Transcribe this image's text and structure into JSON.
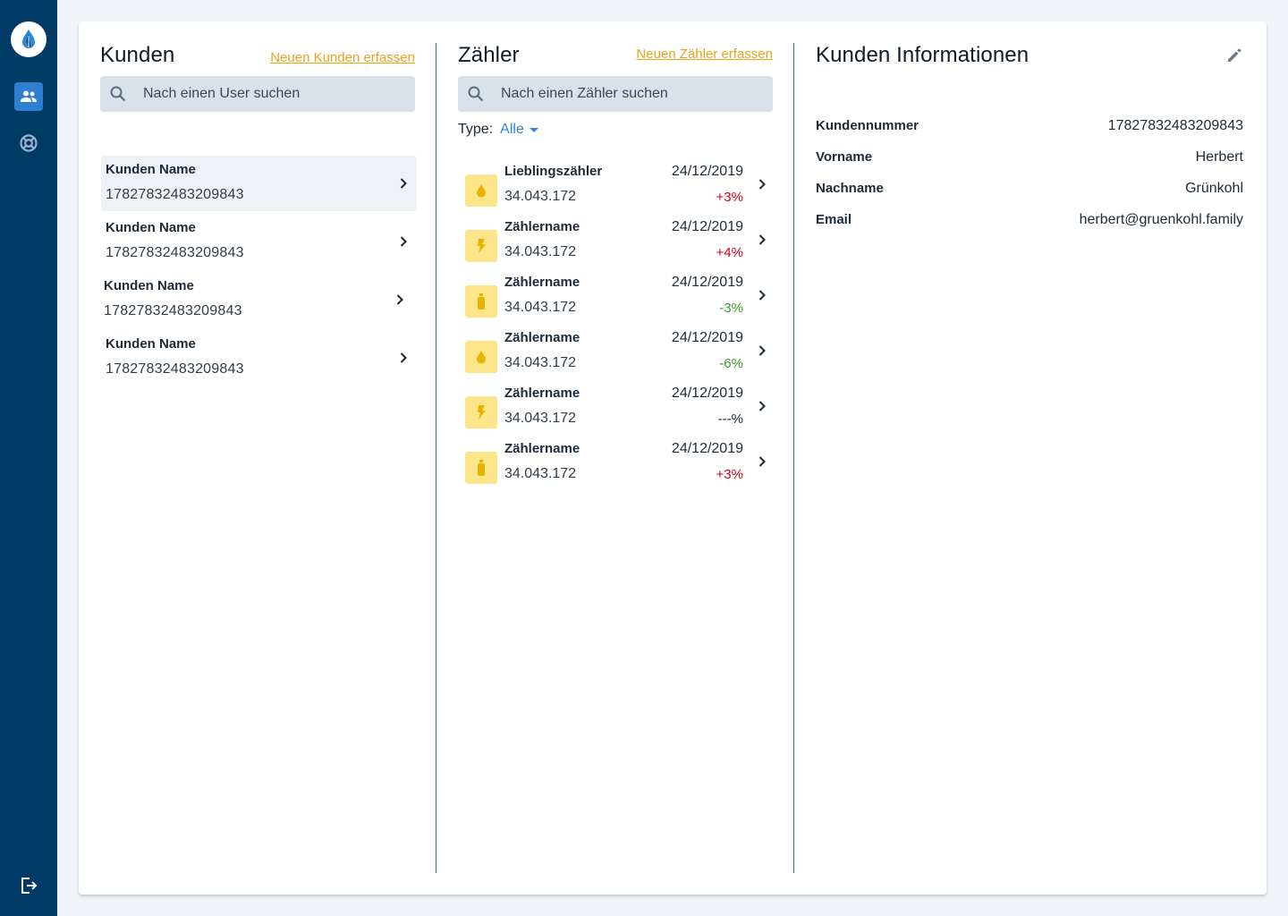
{
  "sidebar": {
    "logo": "water-drop-leaf-logo",
    "items": [
      {
        "name": "customers",
        "icon": "people-icon",
        "active": true
      },
      {
        "name": "meters",
        "icon": "lifebuoy-icon",
        "active": false
      }
    ],
    "logout_icon": "logout-icon"
  },
  "customers": {
    "title": "Kunden",
    "add_link": "Neuen Kunden erfassen",
    "search_placeholder": "Nach einen User suchen",
    "items": [
      {
        "name": "Kunden Name",
        "number": "17827832483209843",
        "selected": true
      },
      {
        "name": "Kunden Name",
        "number": "17827832483209843",
        "selected": false
      },
      {
        "name": "Kunden Name",
        "number": "17827832483209843",
        "selected": false
      },
      {
        "name": "Kunden Name",
        "number": "17827832483209843",
        "selected": false
      }
    ]
  },
  "meters": {
    "title": "Zähler",
    "add_link": "Neuen Zähler erfassen",
    "search_placeholder": "Nach einen Zähler suchen",
    "type_label": "Type:",
    "type_value": "Alle",
    "items": [
      {
        "icon": "water-drop-icon",
        "name": "Lieblingszähler",
        "value": "34.043.172",
        "date": "24/12/2019",
        "change": "+3%",
        "trend": "up"
      },
      {
        "icon": "lightning-icon",
        "name": "Zählername",
        "value": "34.043.172",
        "date": "24/12/2019",
        "change": "+4%",
        "trend": "up"
      },
      {
        "icon": "gas-bottle-icon",
        "name": "Zählername",
        "value": "34.043.172",
        "date": "24/12/2019",
        "change": "-3%",
        "trend": "down"
      },
      {
        "icon": "water-drop-icon",
        "name": "Zählername",
        "value": "34.043.172",
        "date": "24/12/2019",
        "change": "-6%",
        "trend": "down"
      },
      {
        "icon": "lightning-icon",
        "name": "Zählername",
        "value": "34.043.172",
        "date": "24/12/2019",
        "change": "---%",
        "trend": "neutral"
      },
      {
        "icon": "gas-bottle-icon",
        "name": "Zählername",
        "value": "34.043.172",
        "date": "24/12/2019",
        "change": "+3%",
        "trend": "up"
      }
    ]
  },
  "info": {
    "title": "Kunden Informationen",
    "edit_icon": "pencil-icon",
    "rows": [
      {
        "label": "Kundennummer",
        "value": "17827832483209843"
      },
      {
        "label": "Vorname",
        "value": "Herbert"
      },
      {
        "label": "Nachname",
        "value": "Grünkohl"
      },
      {
        "label": "Email",
        "value": "herbert@gruenkohl.family"
      }
    ]
  },
  "colors": {
    "sidebar": "#003a66",
    "accent": "#e8a317",
    "link_blue": "#2f8ad6",
    "up": "#d0021b",
    "down": "#3a9a2c",
    "icon_bg": "#fde58a"
  }
}
